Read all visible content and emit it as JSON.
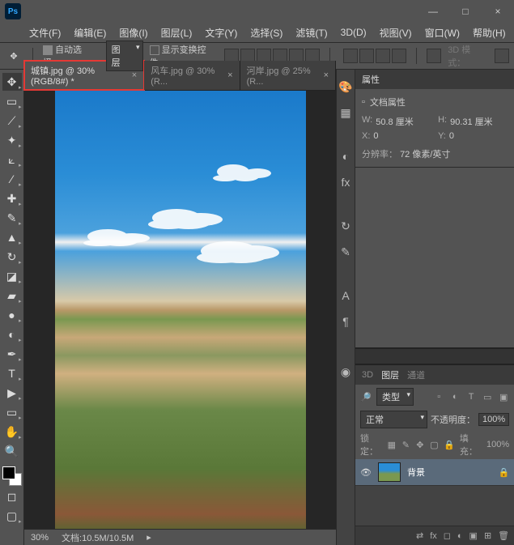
{
  "titlebar": {
    "logo": "Ps",
    "minimize": "—",
    "maximize": "□",
    "close": "×"
  },
  "menubar": {
    "items": [
      "文件(F)",
      "编辑(E)",
      "图像(I)",
      "图层(L)",
      "文字(Y)",
      "选择(S)",
      "滤镜(T)",
      "3D(D)",
      "视图(V)",
      "窗口(W)",
      "帮助(H)"
    ]
  },
  "options": {
    "auto_select_label": "自动选择：",
    "auto_select_target": "图层",
    "show_transform_label": "显示变换控件",
    "mode3d": "3D 模式："
  },
  "tabs": [
    {
      "label": "城镇.jpg @ 30%(RGB/8#) *",
      "active": true,
      "highlight": true
    },
    {
      "label": "风车.jpg @ 30%(R...",
      "active": false
    },
    {
      "label": "河岸.jpg @ 25%(R...",
      "active": false
    }
  ],
  "status": {
    "zoom": "30%",
    "docinfo": "文档:10.5M/10.5M"
  },
  "properties": {
    "panel_title": "属性",
    "doc_props_label": "文档属性",
    "w_label": "W:",
    "w_value": "50.8 厘米",
    "h_label": "H:",
    "h_value": "90.31 厘米",
    "x_label": "X:",
    "x_value": "0",
    "y_label": "Y:",
    "y_value": "0",
    "resolution_label": "分辨率：",
    "resolution_value": "72 像素/英寸"
  },
  "layers_panel": {
    "tab_3d": "3D",
    "tab_layers": "图层",
    "tab_channels": "通道",
    "kind_label": "类型",
    "blend_mode": "正常",
    "opacity_label": "不透明度：",
    "opacity_value": "100%",
    "lock_label": "锁定：",
    "fill_label": "填充：",
    "fill_value": "100%",
    "layer_name": "背景"
  },
  "panel_icons": {
    "color": "color-icon",
    "swatches": "swatches-icon",
    "adjustments": "adjustments-icon",
    "styles": "styles-icon",
    "history": "history-icon",
    "brushes": "brushes-icon",
    "character": "character-icon",
    "paragraph": "paragraph-icon",
    "cc": "cc-icon"
  }
}
